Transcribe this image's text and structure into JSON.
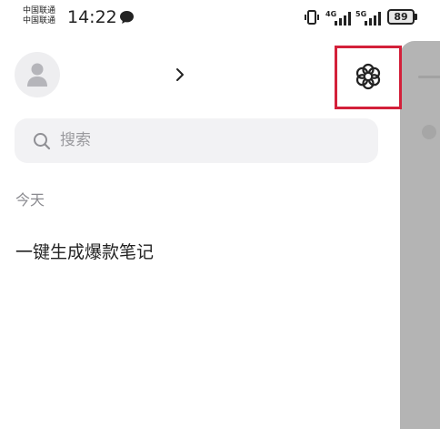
{
  "status_bar": {
    "carrier_line1": "中国联通",
    "carrier_line2": "中国联通",
    "time": "14:22",
    "network1": "4G",
    "network2": "5G",
    "battery": "89",
    "icons": [
      "chat-bubble-icon",
      "vibrate-icon",
      "signal-icon",
      "battery-icon"
    ]
  },
  "profile": {
    "username": "",
    "icons": [
      "avatar-person-icon",
      "chevron-right-icon"
    ]
  },
  "top_action": {
    "icon": "flower-icon",
    "highlight_color": "#d3203a"
  },
  "search": {
    "placeholder": "搜索",
    "icon": "search-icon"
  },
  "history": {
    "section_title": "今天",
    "items": [
      "一键生成爆款笔记"
    ]
  }
}
